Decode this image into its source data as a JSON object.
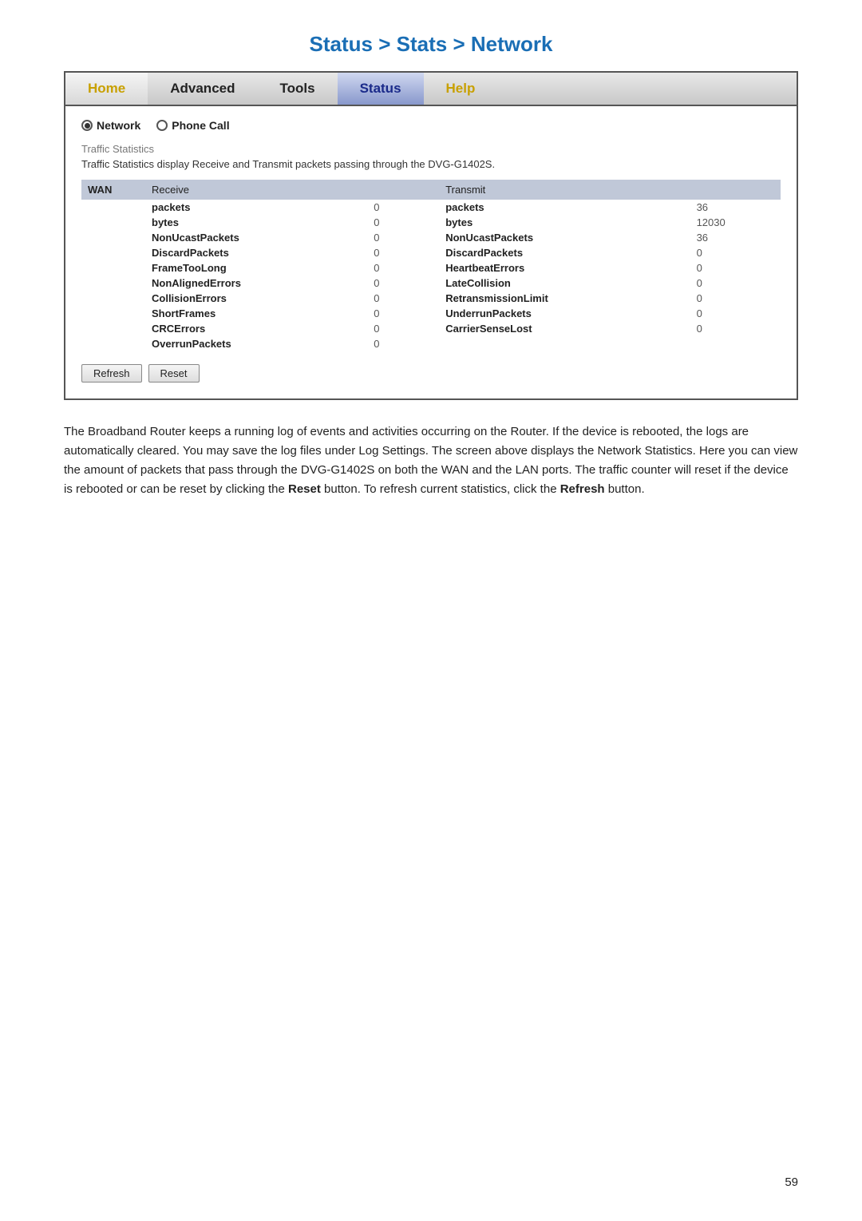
{
  "page": {
    "title": "Status > Stats > Network",
    "page_number": "59"
  },
  "nav": {
    "items": [
      {
        "label": "Home",
        "class": "home"
      },
      {
        "label": "Advanced",
        "class": "advanced"
      },
      {
        "label": "Tools",
        "class": "tools"
      },
      {
        "label": "Status",
        "class": "status"
      },
      {
        "label": "Help",
        "class": "help"
      }
    ]
  },
  "radio": {
    "network_label": "Network",
    "phone_label": "Phone Call"
  },
  "traffic": {
    "section_title": "Traffic Statistics",
    "description": "Traffic Statistics display Receive and Transmit packets passing through the DVG-G1402S."
  },
  "table": {
    "headers": {
      "wan": "WAN",
      "receive": "Receive",
      "transmit": "Transmit"
    },
    "rows": [
      {
        "rx_label": "packets",
        "rx_value": "0",
        "tx_label": "packets",
        "tx_value": "36"
      },
      {
        "rx_label": "bytes",
        "rx_value": "0",
        "tx_label": "bytes",
        "tx_value": "12030"
      },
      {
        "rx_label": "NonUcastPackets",
        "rx_value": "0",
        "tx_label": "NonUcastPackets",
        "tx_value": "36"
      },
      {
        "rx_label": "DiscardPackets",
        "rx_value": "0",
        "tx_label": "DiscardPackets",
        "tx_value": "0"
      },
      {
        "rx_label": "FrameTooLong",
        "rx_value": "0",
        "tx_label": "HeartbeatErrors",
        "tx_value": "0"
      },
      {
        "rx_label": "NonAlignedErrors",
        "rx_value": "0",
        "tx_label": "LateCollision",
        "tx_value": "0"
      },
      {
        "rx_label": "CollisionErrors",
        "rx_value": "0",
        "tx_label": "RetransmissionLimit",
        "tx_value": "0"
      },
      {
        "rx_label": "ShortFrames",
        "rx_value": "0",
        "tx_label": "UnderrunPackets",
        "tx_value": "0"
      },
      {
        "rx_label": "CRCErrors",
        "rx_value": "0",
        "tx_label": "CarrierSenseLost",
        "tx_value": "0"
      },
      {
        "rx_label": "OverrunPackets",
        "rx_value": "0",
        "tx_label": "",
        "tx_value": ""
      }
    ]
  },
  "buttons": {
    "refresh": "Refresh",
    "reset": "Reset"
  },
  "description": "The Broadband Router keeps a running log of events and activities occurring on the Router. If the device is rebooted, the logs are automatically cleared. You may save the log files under Log Settings. The screen above displays the Network Statistics. Here you can view the amount of packets that pass through the DVG-G1402S on both the WAN and the LAN ports. The traffic counter will reset if the device is rebooted or can be reset by clicking the Reset button. To refresh current statistics, click the Refresh button."
}
